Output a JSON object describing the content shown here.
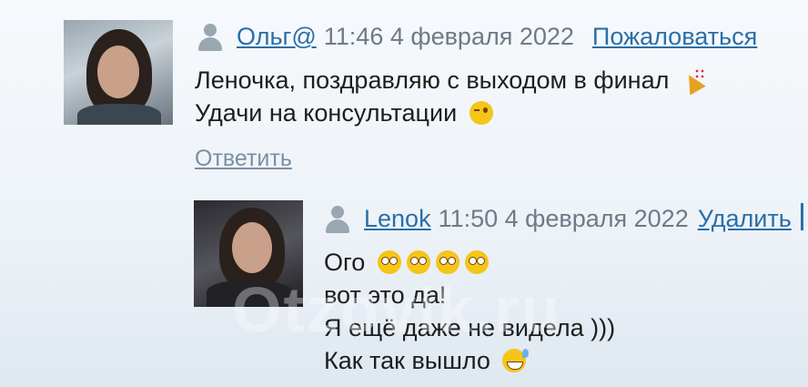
{
  "comments": [
    {
      "author": "Ольг@",
      "time": "11:46 4 февраля 2022",
      "action": "Пожаловаться",
      "text": [
        "Леночка, поздравляю с выходом в финал",
        "Удачи на консультации"
      ],
      "reply": "Ответить"
    },
    {
      "author": "Lenok",
      "time": "11:50 4 февраля 2022",
      "action": "Удалить",
      "text": [
        "Ого",
        "вот это да!",
        "Я ещё даже не видела )))",
        "Как так вышло"
      ]
    }
  ],
  "watermark": "Otzovik.ru",
  "icons": [
    "user-icon",
    "party-popper-icon",
    "wink-emoji-icon",
    "flushed-emoji-icon",
    "sweat-smile-emoji-icon"
  ]
}
